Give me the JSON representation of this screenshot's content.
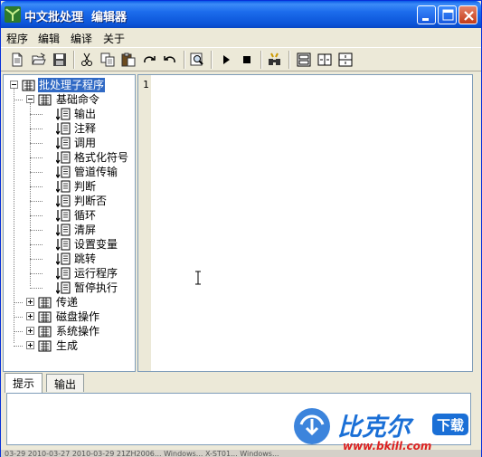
{
  "window": {
    "title": "中文批处理  编辑器",
    "buttons": [
      "minimize",
      "maximize",
      "close"
    ]
  },
  "menu": [
    "程序",
    "编辑",
    "编译",
    "关于"
  ],
  "toolbar": {
    "icons": [
      "new-file-icon",
      "open-folder-icon",
      "save-icon",
      "cut-icon",
      "copy-icon",
      "paste-icon",
      "redo-icon",
      "undo-icon",
      "find-icon",
      "run-icon",
      "stop-icon",
      "debug-icon",
      "window-layout-icon",
      "split-horizontal-icon",
      "split-vertical-icon"
    ]
  },
  "tree": {
    "root": "批处理子程序",
    "basic": {
      "label": "基础命令",
      "items": [
        "输出",
        "注释",
        "调用",
        "格式化符号",
        "管道传输",
        "判断",
        "判断否",
        "循环",
        "清屏",
        "设置变量",
        "跳转",
        "运行程序",
        "暂停执行"
      ]
    },
    "groups": [
      "传递",
      "磁盘操作",
      "系统操作",
      "生成"
    ]
  },
  "editor": {
    "line_numbers": [
      "1"
    ]
  },
  "bottom_tabs": [
    "提示",
    "输出"
  ],
  "status_text": "03-29  2010-03-27  2010-03-29  21ZH2006...  Windows...  X-ST01...  Windows...",
  "watermark": {
    "brand": "比克尔",
    "badge": "下载",
    "site": "www.bkill.com"
  },
  "colors": {
    "titlebar": "#0b54d8",
    "selection": "#316ac5",
    "close": "#c33a17",
    "watermark_blue": "#1a6fd6",
    "watermark_red": "#d22"
  }
}
